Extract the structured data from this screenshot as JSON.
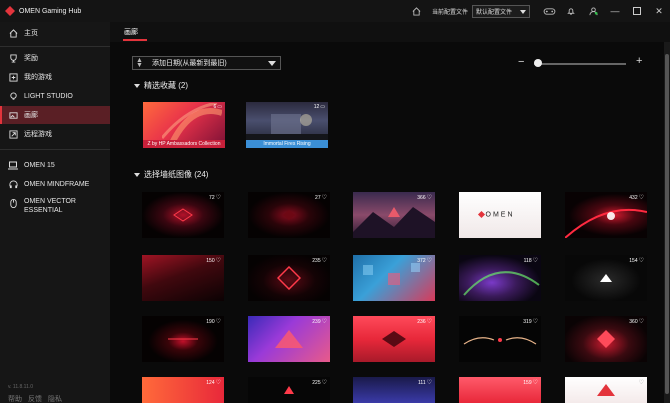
{
  "app": {
    "title": "OMEN Gaming Hub"
  },
  "titlebar": {
    "profile_label": "当前配置文件",
    "profile_value": "默认配置文件",
    "icons": [
      "home-icon",
      "controller-icon",
      "bell-icon",
      "user-icon"
    ],
    "window_buttons": [
      "minimize",
      "maximize",
      "close"
    ]
  },
  "sidebar": {
    "items": [
      {
        "label": "主页",
        "icon": "home-icon"
      },
      {
        "label": "奖励",
        "icon": "trophy-icon"
      },
      {
        "label": "我的游戏",
        "icon": "gamepad-icon"
      },
      {
        "label": "LIGHT STUDIO",
        "icon": "light-icon"
      },
      {
        "label": "画廊",
        "icon": "gallery-icon",
        "active": true
      },
      {
        "label": "远程游戏",
        "icon": "remote-icon"
      }
    ],
    "devices": [
      {
        "label": "OMEN 15",
        "icon": "laptop-icon"
      },
      {
        "label": "OMEN MINDFRAME",
        "icon": "headset-icon"
      },
      {
        "label": "OMEN VECTOR ESSENTIAL",
        "icon": "mouse-icon"
      }
    ],
    "version": "v. 11.8.11.0",
    "footer": [
      "帮助",
      "反馈",
      "隐私"
    ]
  },
  "main": {
    "tab": "画廊",
    "sort_value": "添加日期(从最新到最旧)",
    "sections": {
      "favorites": {
        "title": "精选收藏 (2)"
      },
      "wallpapers": {
        "title": "选择墙纸图像 (24)"
      }
    },
    "collections": [
      {
        "caption": "Z by HP Ambassadors Collection",
        "count": "6"
      },
      {
        "caption": "Immortal Fires Rising",
        "count": "12"
      }
    ],
    "wallpapers": [
      {
        "likes": "72"
      },
      {
        "likes": "27"
      },
      {
        "likes": "366"
      },
      {
        "likes": ""
      },
      {
        "likes": "432"
      },
      {
        "likes": "150"
      },
      {
        "likes": "235"
      },
      {
        "likes": "372"
      },
      {
        "likes": "118"
      },
      {
        "likes": "154"
      },
      {
        "likes": "190"
      },
      {
        "likes": "239"
      },
      {
        "likes": "236"
      },
      {
        "likes": "319"
      },
      {
        "likes": "360"
      },
      {
        "likes": "124"
      },
      {
        "likes": "225"
      },
      {
        "likes": "111"
      },
      {
        "likes": "159"
      },
      {
        "likes": ""
      }
    ],
    "wallpaper_text": {
      "omen_logo": "OMEN"
    }
  },
  "colors": {
    "accent": "#e3343c",
    "active_nav_bg": "#5a1f25"
  }
}
